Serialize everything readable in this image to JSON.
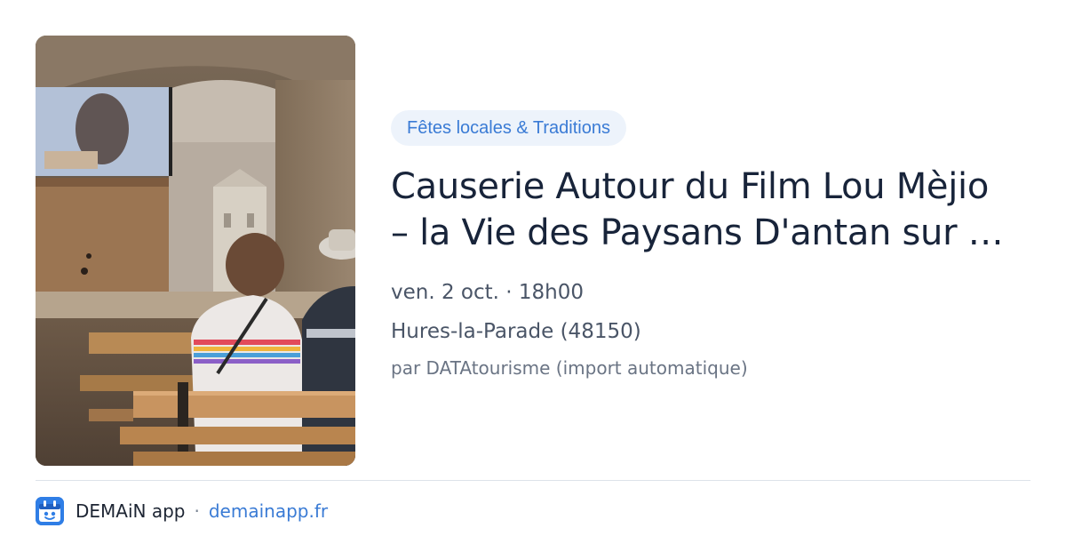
{
  "event": {
    "category": "Fêtes locales & Traditions",
    "title": "Causerie Autour du Film Lou Mèjio – la Vie des Paysans D'antan sur …",
    "datetime": "ven. 2 oct. · 18h00",
    "location": "Hures-la-Parade (48150)",
    "author": "par DATAtourisme (import automatique)"
  },
  "footer": {
    "app_name": "DEMAiN app",
    "separator": "·",
    "url": "demainapp.fr"
  },
  "colors": {
    "accent": "#3a7bd5",
    "category_bg": "#edf3fb",
    "title": "#18243a",
    "app_icon": "#2f7ee6"
  }
}
